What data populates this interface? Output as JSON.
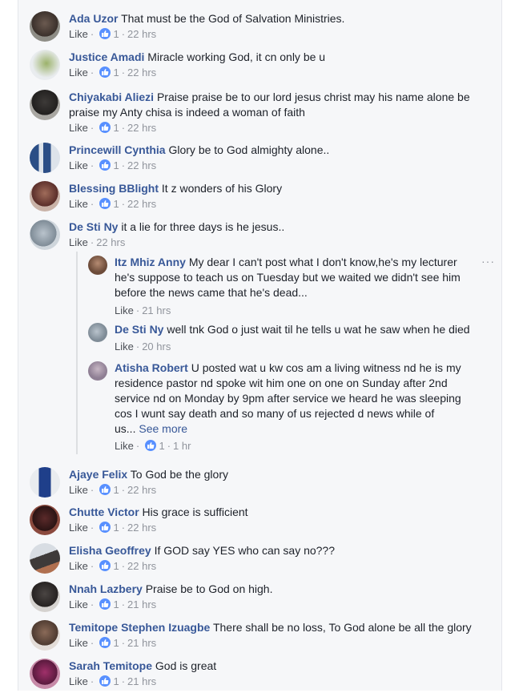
{
  "meta_labels": {
    "like": "Like",
    "dot": "·"
  },
  "comments": [
    {
      "name": "Ada Uzor",
      "text": "That must be the God of Salvation Ministries.",
      "reactions": "1",
      "time": "22 hrs"
    },
    {
      "name": "Justice Amadi",
      "text": "Miracle working God, it cn only be u",
      "reactions": "1",
      "time": "22 hrs"
    },
    {
      "name": "Chiyakabi Aliezi",
      "text_line1": "Praise praise be to our lord jesus christ may his name alone be",
      "text_line2": "praise my Anty chisa is indeed a woman of faith",
      "reactions": "1",
      "time": "22 hrs"
    },
    {
      "name": "Princewill Cynthia",
      "text": "Glory be to God almighty alone..",
      "reactions": "1",
      "time": "22 hrs"
    },
    {
      "name": "Blessing BBlight",
      "text": "It z wonders of his Glory",
      "reactions": "1",
      "time": "22 hrs"
    },
    {
      "name": "De Sti Ny",
      "text": "it a lie for three days is he jesus..",
      "time": "22 hrs"
    },
    {
      "name": "Ajaye Felix",
      "text": "To God be the glory",
      "reactions": "1",
      "time": "22 hrs"
    },
    {
      "name": "Chutte Victor",
      "text": "His grace is sufficient",
      "reactions": "1",
      "time": "22 hrs"
    },
    {
      "name": "Elisha Geoffrey",
      "text": "If GOD say YES who can say no???",
      "reactions": "1",
      "time": "22 hrs"
    },
    {
      "name": "Nnah Lazbery",
      "text": "Praise be to God on high.",
      "reactions": "1",
      "time": "21 hrs"
    },
    {
      "name": "Temitope Stephen Izuagbe",
      "text": "There shall be no loss, To God alone be all the glory",
      "reactions": "1",
      "time": "21 hrs"
    },
    {
      "name": "Sarah Temitope",
      "text": "God is great",
      "reactions": "1",
      "time": "21 hrs"
    }
  ],
  "replies": [
    {
      "name": "Itz Mhiz Anny",
      "line1": "My dear I can't post what I don't know,he's my lecturer",
      "line2": "he's suppose to teach us on Tuesday but we waited we didn't see him",
      "line3": "before the news came that he's dead...",
      "time": "21 hrs"
    },
    {
      "name": "De Sti Ny",
      "text": "well tnk God o just wait til he tells u wat he saw when he died",
      "time": "20 hrs"
    },
    {
      "name": "Atisha Robert",
      "line1": "U posted wat u kw cos am a living witness nd he is my",
      "line2": "residence pastor nd spoke wit him one on one on Sunday after 2nd",
      "line3": "service nd on Monday by 9pm after service we heard he was sleeping",
      "line4": "cos I wunt say death and so many of us rejected d news while of",
      "line5": "us...",
      "see_more": "See more",
      "reactions": "1",
      "time": "1 hr"
    }
  ],
  "more_options": "···",
  "colors": {
    "link": "#385898",
    "meta": "#90949c",
    "reaction": "#5890ff",
    "background": "#f6f7f9"
  }
}
